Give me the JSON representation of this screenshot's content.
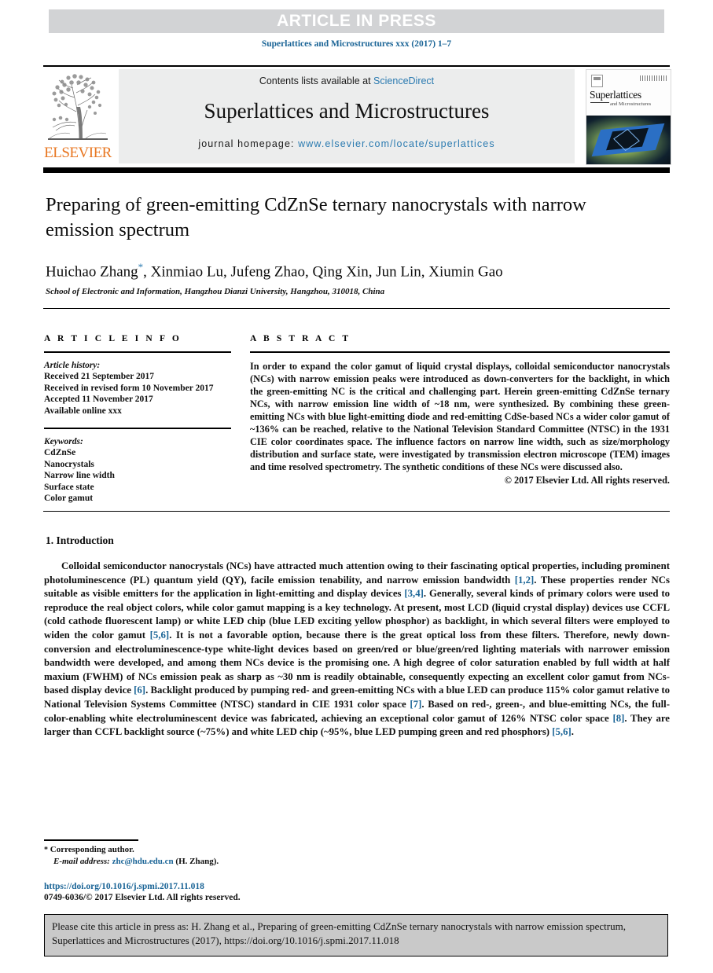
{
  "header": {
    "article_in_press": "ARTICLE IN PRESS",
    "running_head": "Superlattices and Microstructures xxx (2017) 1–7"
  },
  "journal_header": {
    "contents_prefix": "Contents lists available at ",
    "contents_link": "ScienceDirect",
    "journal_name": "Superlattices and Microstructures",
    "homepage_prefix": "journal homepage: ",
    "homepage_url": "www.elsevier.com/locate/superlattices",
    "publisher_logo_text": "ELSEVIER",
    "cover_title": "Superlattices",
    "cover_subtitle": "and Microstructures",
    "link_color": "#2a7ab0",
    "logo_color": "#e87722"
  },
  "article": {
    "title": "Preparing of green-emitting CdZnSe ternary nanocrystals with narrow emission spectrum",
    "authors": "Huichao Zhang",
    "corresponding_marker": "*",
    "authors_rest": ", Xinmiao Lu, Jufeng Zhao, Qing Xin, Jun Lin, Xiumin Gao",
    "affiliation": "School of Electronic and Information, Hangzhou Dianzi University, Hangzhou, 310018, China"
  },
  "article_info": {
    "label": "A R T I C L E   I N F O",
    "history_label": "Article history:",
    "history": [
      "Received 21 September 2017",
      "Received in revised form 10 November 2017",
      "Accepted 11 November 2017",
      "Available online xxx"
    ],
    "keywords_label": "Keywords:",
    "keywords": [
      "CdZnSe",
      "Nanocrystals",
      "Narrow line width",
      "Surface state",
      "Color gamut"
    ]
  },
  "abstract": {
    "label": "A B S T R A C T",
    "text": "In order to expand the color gamut of liquid crystal displays, colloidal semiconductor nanocrystals (NCs) with narrow emission peaks were introduced as down-converters for the backlight, in which the green-emitting NC is the critical and challenging part. Herein green-emitting CdZnSe ternary NCs, with narrow emission line width of ~18 nm, were synthesized. By combining these green-emitting NCs with blue light-emitting diode and red-emitting CdSe-based NCs a wider color gamut of ~136% can be reached, relative to the National Television Standard Committee (NTSC) in the 1931 CIE color coordinates space. The influence factors on narrow line width, such as size/morphology distribution and surface state, were investigated by transmission electron microscope (TEM) images and time resolved spectrometry. The synthetic conditions of these NCs were discussed also.",
    "copyright": "© 2017 Elsevier Ltd. All rights reserved."
  },
  "introduction": {
    "heading": "1. Introduction",
    "paragraph_1": "Colloidal semiconductor nanocrystals (NCs) have attracted much attention owing to their fascinating optical properties, including prominent photoluminescence (PL) quantum yield (QY), facile emission tenability, and narrow emission bandwidth ",
    "ref_1": "[1,2]",
    "paragraph_2": ". These properties render NCs suitable as visible emitters for the application in light-emitting and display devices ",
    "ref_2": "[3,4]",
    "paragraph_3": ". Generally, several kinds of primary colors were used to reproduce the real object colors, while color gamut mapping is a key technology. At present, most LCD (liquid crystal display) devices use CCFL (cold cathode fluorescent lamp) or white LED chip (blue LED exciting yellow phosphor) as backlight, in which several filters were employed to widen the color gamut ",
    "ref_3": "[5,6]",
    "paragraph_4": ". It is not a favorable option, because there is the great optical loss from these filters. Therefore, newly down-conversion and electroluminescence-type white-light devices based on green/red or blue/green/red lighting materials with narrower emission bandwidth were developed, and among them NCs device is the promising one. A high degree of color saturation enabled by full width at half maxium (FWHM) of NCs emission peak as sharp as ~30 nm is readily obtainable, consequently expecting an excellent color gamut from NCs-based display device ",
    "ref_4": "[6]",
    "paragraph_5": ". Backlight produced by pumping red- and green-emitting NCs with a blue LED can produce 115% color gamut relative to National Television Systems Committee (NTSC) standard in CIE 1931 color space ",
    "ref_5": "[7]",
    "paragraph_6": ". Based on red-, green-, and blue-emitting NCs, the full-color-enabling white electroluminescent device was fabricated, achieving an exceptional color gamut of 126% NTSC color space ",
    "ref_6": "[8]",
    "paragraph_7": ". They are larger than CCFL backlight source (~75%) and white LED chip (~95%, blue LED pumping green and red phosphors) ",
    "ref_7": "[5,6]",
    "paragraph_8": "."
  },
  "footer": {
    "corresponding_star": "*",
    "corresponding_text": "Corresponding author.",
    "email_label": "E-mail address:",
    "email": "zhc@hdu.edu.cn",
    "email_owner": "(H. Zhang).",
    "doi": "https://doi.org/10.1016/j.spmi.2017.11.018",
    "issn_line": "0749-6036/© 2017 Elsevier Ltd. All rights reserved."
  },
  "cite_box": {
    "text": "Please cite this article in press as: H. Zhang et al., Preparing of green-emitting CdZnSe ternary nanocrystals with narrow emission spectrum, Superlattices and Microstructures (2017), https://doi.org/10.1016/j.spmi.2017.11.018"
  }
}
